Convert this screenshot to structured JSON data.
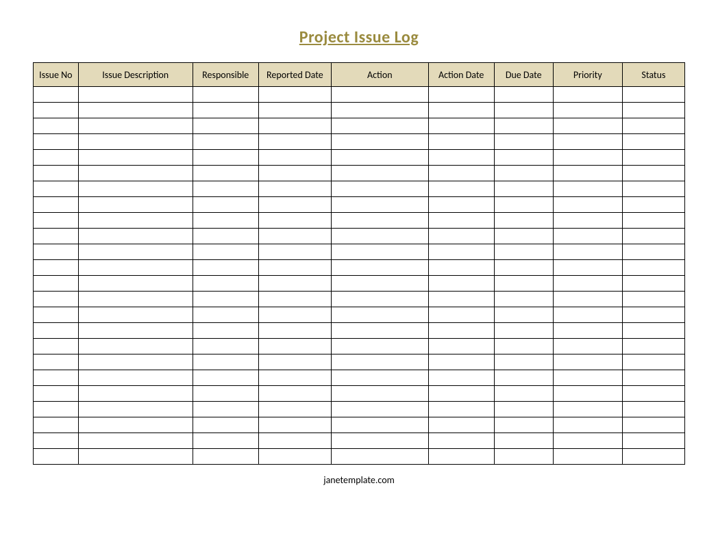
{
  "title": "Project Issue Log",
  "footer": "janetemplate.com",
  "columns": [
    "Issue No",
    "Issue Description",
    "Responsible",
    "Reported Date",
    "Action",
    "Action Date",
    "Due Date",
    "Priority",
    "Status"
  ],
  "row_count": 24
}
